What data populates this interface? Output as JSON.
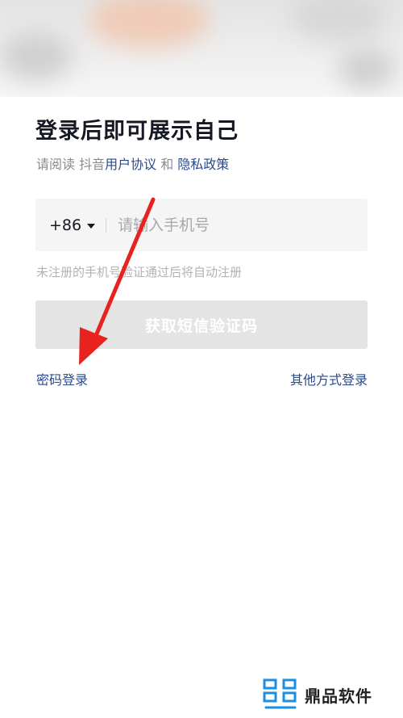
{
  "login": {
    "title": "登录后即可展示自己",
    "agreement": {
      "prefix": "请阅读 抖音",
      "user_agreement": "用户协议",
      "conjunction": " 和 ",
      "privacy_policy": "隐私政策"
    },
    "phone": {
      "country_code": "+86",
      "placeholder": "请输入手机号"
    },
    "hint": "未注册的手机号验证通过后将自动注册",
    "sms_button": "获取短信验证码",
    "password_login": "密码登录",
    "other_login": "其他方式登录"
  },
  "watermark": {
    "text": "鼎品软件"
  },
  "colors": {
    "link": "#2a4a8f",
    "arrow": "#e8231f",
    "button_disabled": "#e4e4e4"
  }
}
